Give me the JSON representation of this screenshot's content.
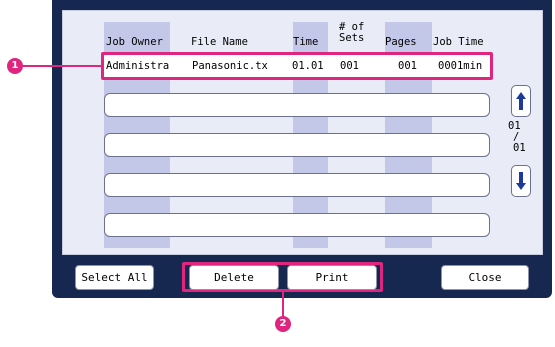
{
  "table": {
    "headers": {
      "job_owner": "Job Owner",
      "file_name": "File Name",
      "time": "Time",
      "sets_line1": "# of",
      "sets_line2": "Sets",
      "pages": "Pages",
      "job_time": "Job Time"
    },
    "rows": [
      {
        "job_owner": "Administra",
        "file_name": "Panasonic.tx",
        "time": "01.01",
        "sets": "001",
        "pages": "001",
        "job_time": "0001min"
      }
    ]
  },
  "pagination": {
    "current": "01",
    "separator": "/",
    "total": "01"
  },
  "buttons": {
    "select_all": "Select All",
    "delete": "Delete",
    "print": "Print",
    "close": "Close"
  },
  "callouts": {
    "one": "1",
    "two": "2"
  },
  "colors": {
    "highlight": "#e0257f",
    "frame": "#16284f",
    "panel": "#e9ebf6",
    "column_band": "#c4c8e8"
  },
  "icons": {
    "scroll_up": "arrow-up-icon",
    "scroll_down": "arrow-down-icon"
  }
}
